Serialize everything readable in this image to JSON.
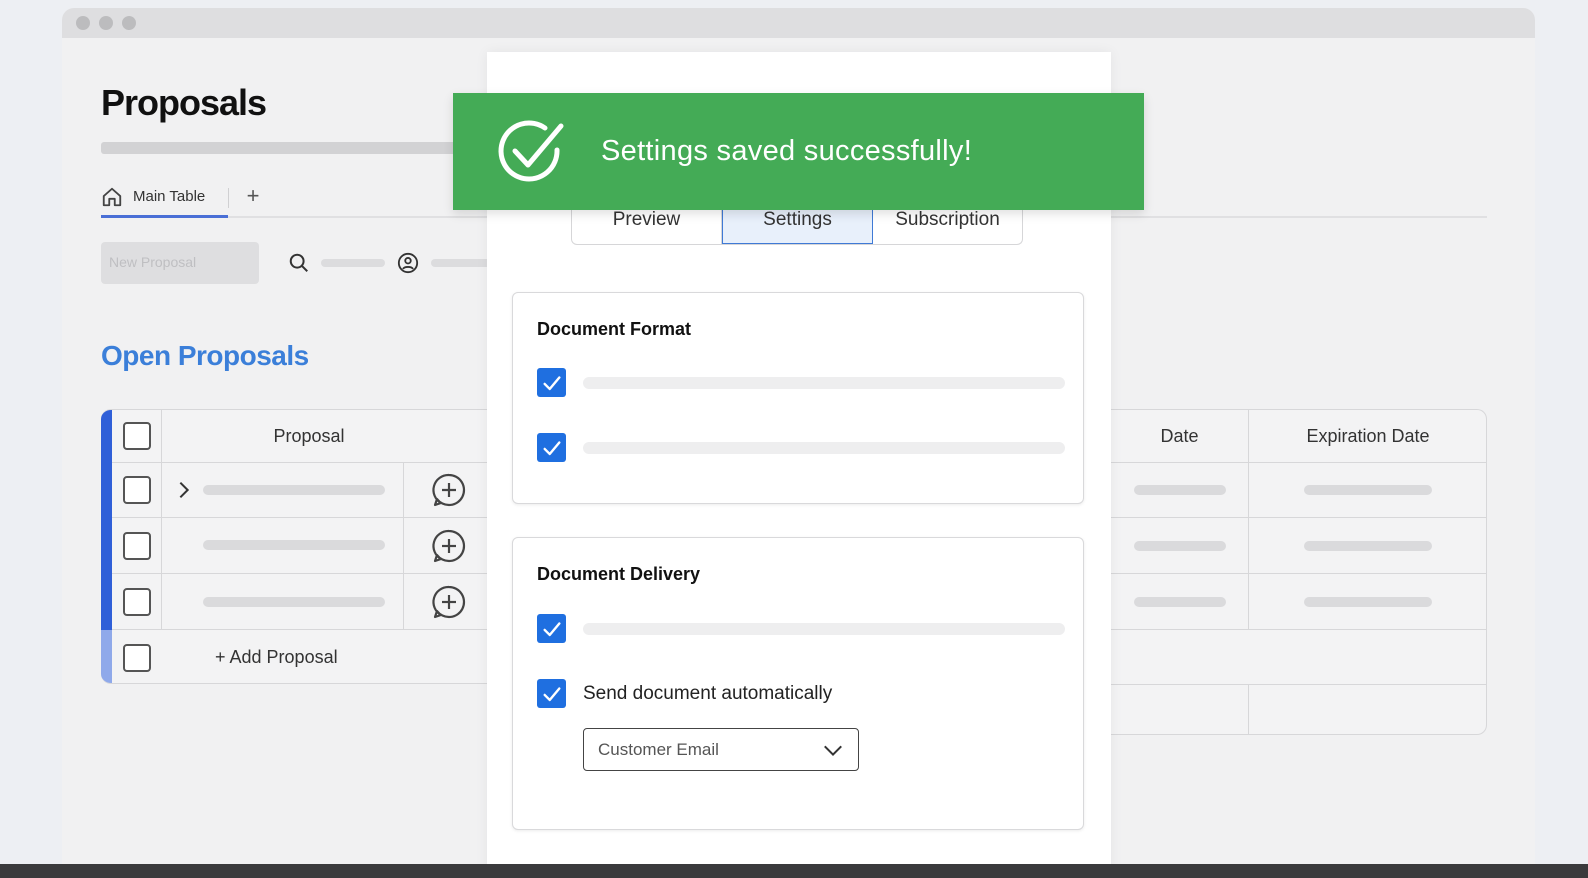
{
  "page": {
    "title": "Proposals",
    "section_title": "Open Proposals"
  },
  "tabs": {
    "main_table": "Main Table",
    "add": "+"
  },
  "toolbar": {
    "new_proposal_label": "New Proposal"
  },
  "table": {
    "columns": {
      "proposal": "Proposal",
      "date": "Date",
      "expiration_date": "Expiration Date"
    },
    "add_row_label": "+ Add Proposal"
  },
  "modal": {
    "tabs": [
      {
        "label": "Preview"
      },
      {
        "label": "Settings"
      },
      {
        "label": "Subscription"
      }
    ],
    "document_format": {
      "title": "Document Format"
    },
    "document_delivery": {
      "title": "Document Delivery",
      "send_auto_label": "Send document automatically",
      "delivery_select_value": "Customer Email"
    }
  },
  "toast": {
    "message": "Settings saved successfully!"
  },
  "colors": {
    "accent_blue": "#2f5fd8",
    "link_blue": "#3b7fd9",
    "checkbox_blue": "#1f6fe0",
    "toast_green": "#44ab56"
  },
  "icons": [
    "home-icon",
    "search-icon",
    "person-icon",
    "chevron-right-icon",
    "add-comment-icon",
    "check-icon",
    "chevron-down-icon",
    "check-circle-icon"
  ]
}
